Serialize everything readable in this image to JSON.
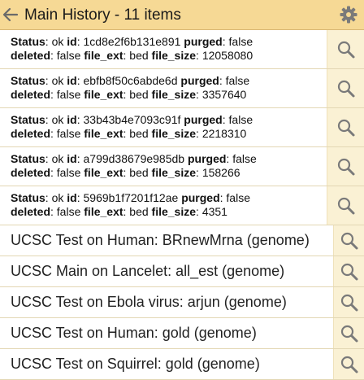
{
  "header": {
    "title": "Main History - 11 items",
    "back_icon": "arrow-left-icon",
    "settings_icon": "gear-icon",
    "background": "#f6d995"
  },
  "labels": {
    "status": "Status",
    "id": "id",
    "purged": "purged",
    "deleted": "deleted",
    "file_ext": "file_ext",
    "file_size": "file_size"
  },
  "datasets": [
    {
      "status": "ok",
      "id": "1cd8e2f6b131e891",
      "purged": "false",
      "deleted": "false",
      "file_ext": "bed",
      "file_size": "12058080"
    },
    {
      "status": "ok",
      "id": "ebfb8f50c6abde6d",
      "purged": "false",
      "deleted": "false",
      "file_ext": "bed",
      "file_size": "3357640"
    },
    {
      "status": "ok",
      "id": "33b43b4e7093c91f",
      "purged": "false",
      "deleted": "false",
      "file_ext": "bed",
      "file_size": "2218310"
    },
    {
      "status": "ok",
      "id": "a799d38679e985db",
      "purged": "false",
      "deleted": "false",
      "file_ext": "bed",
      "file_size": "158266"
    },
    {
      "status": "ok",
      "id": "5969b1f7201f12ae",
      "purged": "false",
      "deleted": "false",
      "file_ext": "bed",
      "file_size": "4351"
    }
  ],
  "items": [
    {
      "label": "UCSC Test on Human: BRnewMrna (genome)"
    },
    {
      "label": "UCSC Main on Lancelet: all_est (genome)"
    },
    {
      "label": "UCSC Test on Ebola virus: arjun (genome)"
    },
    {
      "label": "UCSC Test on Human: gold (genome)"
    },
    {
      "label": "UCSC Test on Squirrel: gold (genome)"
    }
  ],
  "row_action_icon": "search-icon",
  "colors": {
    "action_background": "#faf1d4",
    "divider": "#e3d7b4"
  }
}
